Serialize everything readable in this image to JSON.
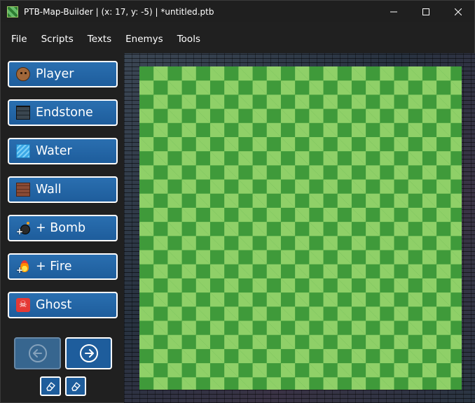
{
  "window": {
    "title": "PTB-Map-Builder | (x: 17, y: -5) | *untitled.ptb",
    "controls": [
      "minimize",
      "maximize",
      "close"
    ]
  },
  "menu": {
    "items": [
      "File",
      "Scripts",
      "Texts",
      "Enemys",
      "Tools"
    ]
  },
  "sidebar": {
    "tools": [
      {
        "label": "Player",
        "icon": "player-face-icon"
      },
      {
        "label": "Endstone",
        "icon": "endstone-block-icon"
      },
      {
        "label": "Water",
        "icon": "water-tile-icon"
      },
      {
        "label": "Wall",
        "icon": "brick-wall-icon"
      },
      {
        "label": "+ Bomb",
        "icon": "bomb-icon"
      },
      {
        "label": "+ Fire",
        "icon": "fire-icon"
      },
      {
        "label": "Ghost",
        "icon": "skull-icon"
      }
    ],
    "nav": {
      "back": {
        "icon": "arrow-left-circle-icon",
        "enabled": false
      },
      "forward": {
        "icon": "arrow-right-circle-icon",
        "enabled": true
      }
    },
    "erasers": [
      "eraser-icon",
      "eraser-icon"
    ]
  },
  "map": {
    "cursor": {
      "x": 17,
      "y": -5
    },
    "colors": {
      "grass_dark": "#3f9a3a",
      "grass_light": "#8fd068",
      "border": "#2b3440"
    }
  },
  "colors": {
    "button_bg": "#1e5d9c",
    "button_border": "#ffffff",
    "chrome_bg": "#202020"
  }
}
